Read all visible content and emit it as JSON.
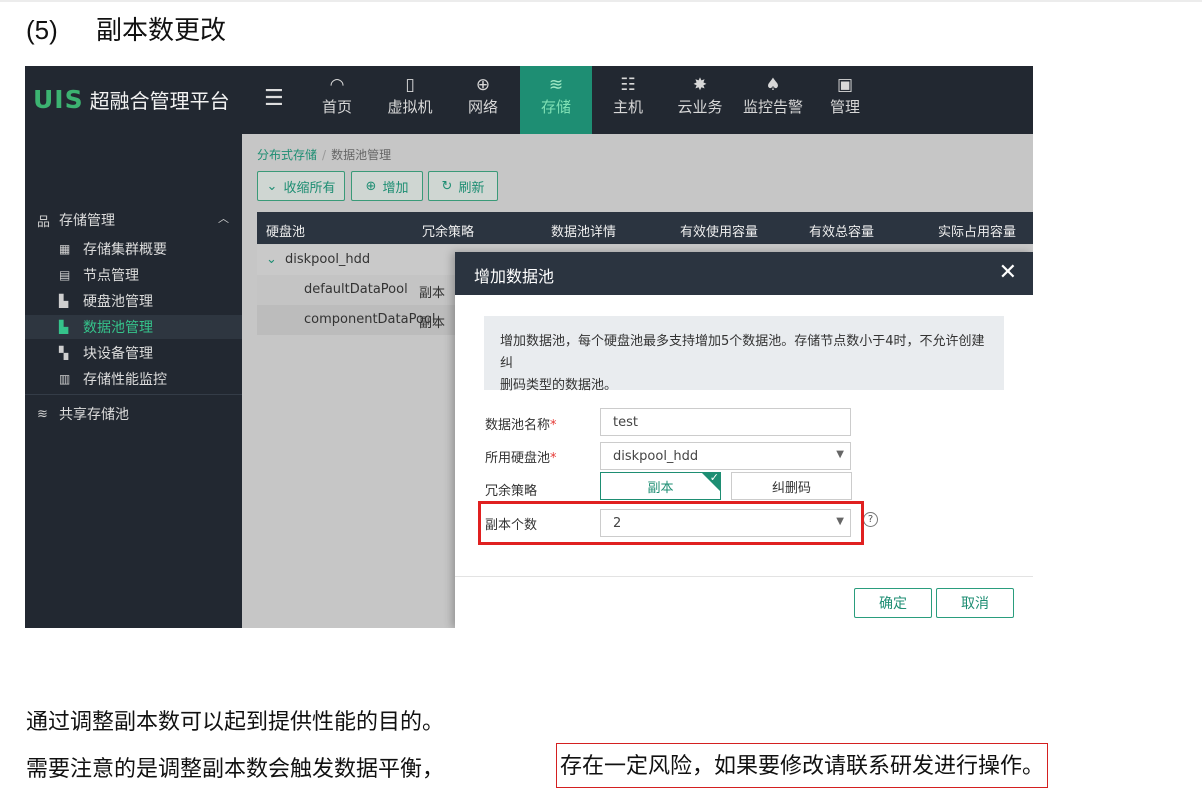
{
  "doc": {
    "heading_num": "(5)",
    "heading_text": "副本数更改",
    "para1": "通过调整副本数可以起到提供性能的目的。",
    "para2_prefix": "需要注意的是调整副本数会触发数据平衡，",
    "para2_highlight": "存在一定风险，如果要修改请联系研发进行操作。"
  },
  "app": {
    "logo_mark": "UIS",
    "logo_text": "超融合管理平台",
    "menu_icon": "hamburger-icon",
    "nav": [
      {
        "label": "首页",
        "icon": "dashboard-icon"
      },
      {
        "label": "虚拟机",
        "icon": "vm-icon"
      },
      {
        "label": "网络",
        "icon": "globe-icon"
      },
      {
        "label": "存储",
        "icon": "database-icon",
        "active": true
      },
      {
        "label": "主机",
        "icon": "server-icon"
      },
      {
        "label": "云业务",
        "icon": "gear-icon"
      },
      {
        "label": "监控告警",
        "icon": "bell-icon"
      },
      {
        "label": "管理",
        "icon": "monitor-icon"
      }
    ],
    "sidebar": {
      "group1": "存储管理",
      "items": [
        {
          "label": "存储集群概要",
          "icon": "cluster-icon"
        },
        {
          "label": "节点管理",
          "icon": "node-icon"
        },
        {
          "label": "硬盘池管理",
          "icon": "disk-pool-icon"
        },
        {
          "label": "数据池管理",
          "icon": "data-pool-icon",
          "active": true
        },
        {
          "label": "块设备管理",
          "icon": "block-device-icon"
        },
        {
          "label": "存储性能监控",
          "icon": "performance-icon"
        }
      ],
      "group2": "共享存储池"
    },
    "breadcrumb": {
      "parent": "分布式存储",
      "sep": "/",
      "current": "数据池管理"
    },
    "toolbar": {
      "collapse": "收缩所有",
      "add": "增加",
      "refresh": "刷新"
    },
    "table": {
      "headers": [
        "硬盘池",
        "冗余策略",
        "数据池详情",
        "有效使用容量",
        "有效总容量",
        "实际占用容量"
      ],
      "group_row": "diskpool_hdd",
      "rows": [
        {
          "name": "defaultDataPool",
          "policy": "副本"
        },
        {
          "name": "componentDataPool",
          "policy": "副本"
        }
      ]
    },
    "modal": {
      "title": "增加数据池",
      "close": "✕",
      "notice_line1": "增加数据池，每个硬盘池最多支持增加5个数据池。存储节点数小于4时，不允许创建纠",
      "notice_line2": "删码类型的数据池。",
      "name_label": "数据池名称",
      "name_value": "test",
      "diskpool_label": "所用硬盘池",
      "diskpool_value": "diskpool_hdd",
      "redundancy_label": "冗余策略",
      "redundancy_options": [
        "副本",
        "纠删码"
      ],
      "redundancy_selected": "副本",
      "replica_label": "副本个数",
      "replica_value": "2",
      "required_mark": "*",
      "help": "?",
      "confirm": "确定",
      "cancel": "取消"
    }
  }
}
